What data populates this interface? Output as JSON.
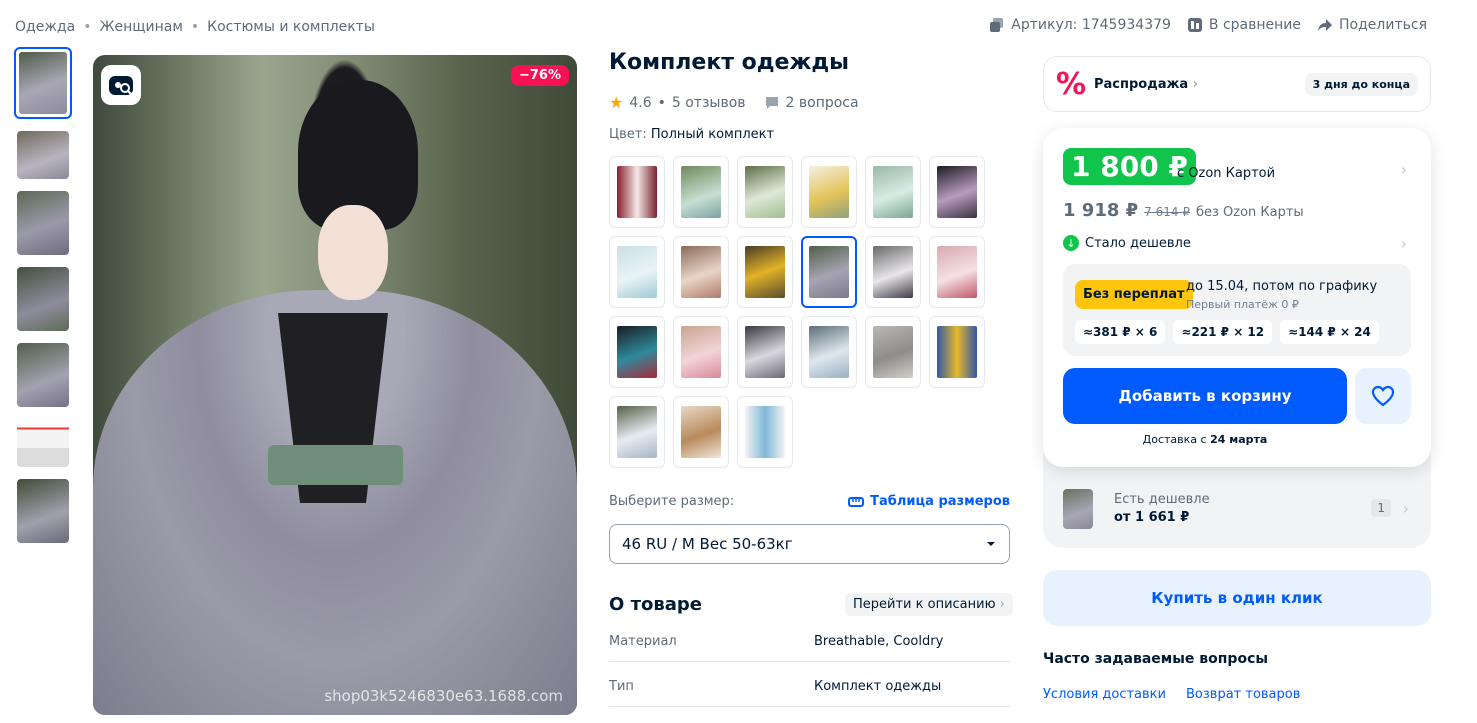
{
  "breadcrumbs": [
    "Одежда",
    "Женщинам",
    "Костюмы и комплекты"
  ],
  "top_actions": {
    "article": "Артикул: 1745934379",
    "compare": "В сравнение",
    "share": "Поделиться"
  },
  "gallery": {
    "discount_badge": "−76%",
    "watermark": "shop03k5246830e63.1688.com",
    "thumb_count": 7
  },
  "product": {
    "title": "Комплект одежды",
    "rating": "4.6",
    "reviews": "5 отзывов",
    "questions": "2 вопроса",
    "color_label": "Цвет:",
    "color_value": "Полный комплект"
  },
  "size": {
    "label": "Выберите размер:",
    "table_link": "Таблица размеров",
    "selected": "46 RU / M Вес 50-63кг"
  },
  "about": {
    "title": "О товаре",
    "link": "Перейти к описанию",
    "props": [
      {
        "k": "Материал",
        "v": "Breathable, Cooldry"
      },
      {
        "k": "Тип",
        "v": "Комплект одежды"
      }
    ]
  },
  "sale": {
    "icon": "%",
    "label": "Распродажа",
    "days": "3 дня до конца"
  },
  "price": {
    "card_price": "1 800 ₽",
    "card_label": "с Ozon Картой",
    "regular_price": "1 918 ₽",
    "old_price": "7 614 ₽",
    "regular_label": "без Ozon Карты",
    "cheaper_label": "Стало дешевле"
  },
  "installment": {
    "badge": "Без переплат",
    "line1": "до 15.04, потом по графику",
    "line2": "Первый платёж 0 ₽",
    "chips": [
      "≈381 ₽ × 6",
      "≈221 ₽ × 12",
      "≈144 ₽ × 24"
    ]
  },
  "cart": {
    "add_label": "Добавить в корзину",
    "delivery_prefix": "Доставка с ",
    "delivery_date": "24 марта"
  },
  "cheaper_offer": {
    "line1": "Есть дешевле",
    "line2": "от 1 661 ₽",
    "count": "1"
  },
  "oneclick": "Купить в один клик",
  "faq": {
    "title": "Часто задаваемые вопросы",
    "links": [
      "Условия доставки",
      "Возврат товаров"
    ]
  },
  "colors": {
    "accent": "#005bff",
    "price_green": "#10c44c",
    "sale_pink": "#f91155",
    "installment_yellow": "#ffc50c"
  }
}
